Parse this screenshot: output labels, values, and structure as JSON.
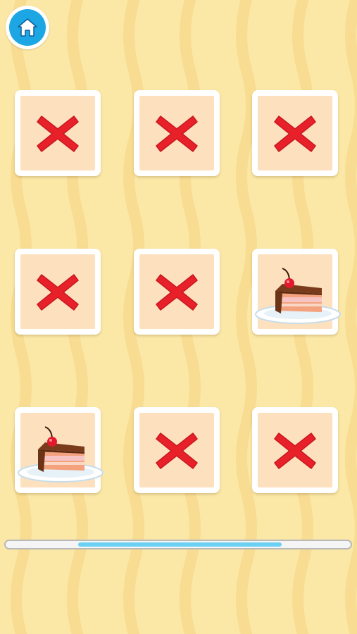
{
  "colors": {
    "background": "#fbe7a6",
    "card_face": "#fde1bf",
    "cross": "#e8202a",
    "home_button": "#1da6e4",
    "progress_fill": "#6cd0f3"
  },
  "header": {
    "home_icon": "home-icon"
  },
  "grid": {
    "rows": 3,
    "cols": 3,
    "cards": [
      {
        "content": "cross"
      },
      {
        "content": "cross"
      },
      {
        "content": "cross"
      },
      {
        "content": "cross"
      },
      {
        "content": "cross"
      },
      {
        "content": "cake"
      },
      {
        "content": "cake"
      },
      {
        "content": "cross"
      },
      {
        "content": "cross"
      }
    ]
  },
  "progress": {
    "start": 0.21,
    "end": 0.8
  }
}
